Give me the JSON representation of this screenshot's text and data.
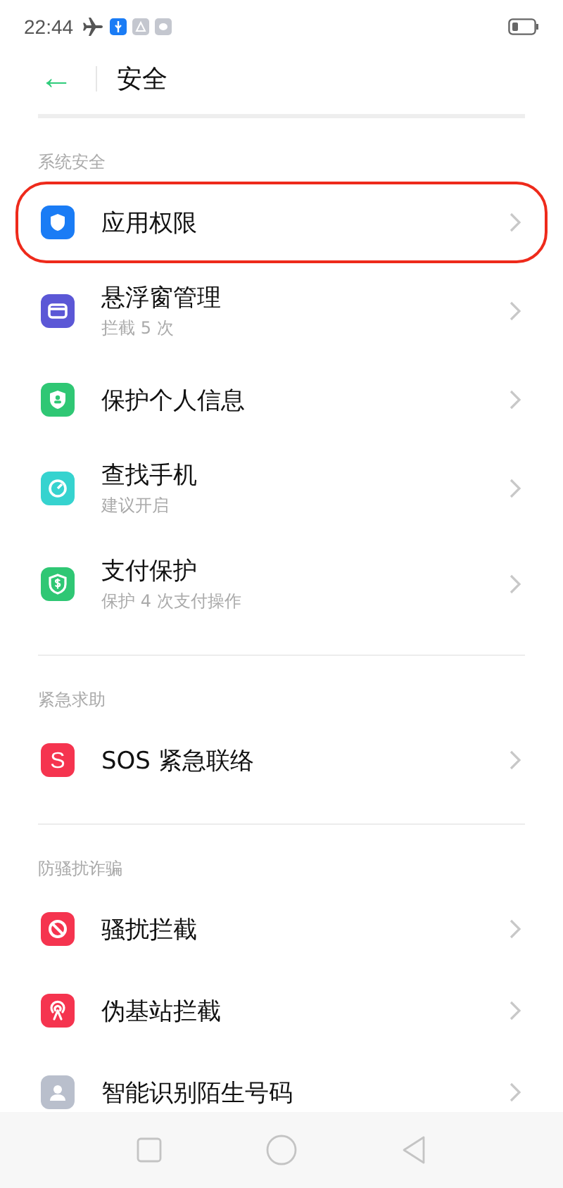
{
  "status_bar": {
    "time": "22:44"
  },
  "header": {
    "back": "←",
    "title": "安全"
  },
  "sections": [
    {
      "title": "系统安全",
      "items": [
        {
          "label": "应用权限",
          "highlighted": true,
          "kind": "shield",
          "color": "#1a7cf5"
        },
        {
          "label": "悬浮窗管理",
          "subtitle": "拦截 5 次",
          "highlighted": false,
          "kind": "window",
          "color": "#5b57d6"
        },
        {
          "label": "保护个人信息",
          "highlighted": false,
          "kind": "person-shield",
          "color": "#2fc774"
        },
        {
          "label": "查找手机",
          "subtitle": "建议开启",
          "highlighted": false,
          "kind": "gauge",
          "color": "#36d3cf"
        },
        {
          "label": "支付保护",
          "subtitle": "保护 4 次支付操作",
          "highlighted": false,
          "kind": "money-shield",
          "color": "#2fc774"
        }
      ]
    },
    {
      "title": "紧急求助",
      "items": [
        {
          "label": "SOS 紧急联络",
          "highlighted": false,
          "kind": "letter",
          "glyph": "S",
          "color": "#f5344f"
        }
      ]
    },
    {
      "title": "防骚扰诈骗",
      "items": [
        {
          "label": "骚扰拦截",
          "highlighted": false,
          "kind": "block",
          "color": "#f5344f"
        },
        {
          "label": "伪基站拦截",
          "highlighted": false,
          "kind": "antenna",
          "color": "#f5344f"
        },
        {
          "label": "智能识别陌生号码",
          "highlighted": false,
          "kind": "unknown-person",
          "color": "#b9bfcc"
        }
      ]
    }
  ]
}
